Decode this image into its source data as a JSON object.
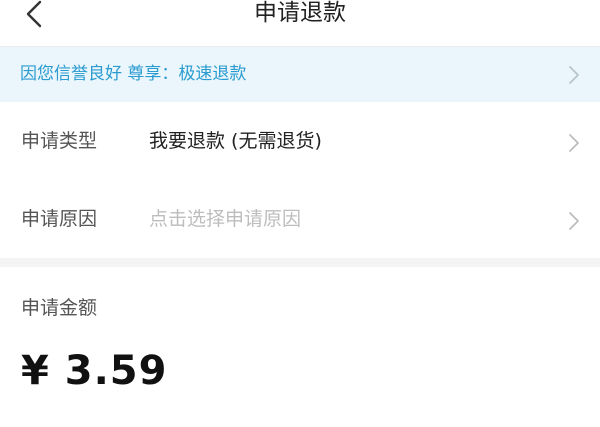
{
  "header": {
    "title": "申请退款",
    "back_icon": "chevron-left-icon"
  },
  "notice": {
    "text": "因您信誉良好 尊享：极速退款",
    "color": "#2a9bd1",
    "icon": "chevron-right-icon"
  },
  "form": {
    "rows": [
      {
        "label": "申请类型",
        "value": "我要退款 (无需退货)",
        "icon": "chevron-right-icon"
      },
      {
        "label": "申请原因",
        "placeholder": "点击选择申请原因",
        "icon": "chevron-right-icon"
      }
    ]
  },
  "amount": {
    "label": "申请金额",
    "value": "¥ 3.59"
  }
}
